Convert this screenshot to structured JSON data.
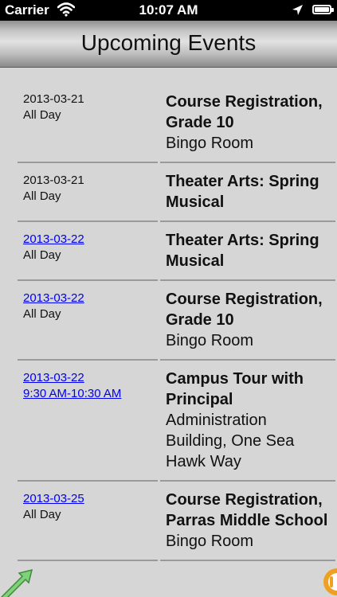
{
  "status_bar": {
    "carrier": "Carrier",
    "time": "10:07 AM",
    "icons": [
      "wifi-icon",
      "location-arrow-icon",
      "battery-icon"
    ]
  },
  "nav": {
    "title": "Upcoming Events"
  },
  "events": [
    {
      "date": "2013-03-21",
      "time": "All Day",
      "date_is_link": false,
      "time_is_link": false,
      "title": "Course Registration, Grade 10",
      "location": "Bingo Room"
    },
    {
      "date": "2013-03-21",
      "time": "All Day",
      "date_is_link": false,
      "time_is_link": false,
      "title": "Theater Arts: Spring Musical",
      "location": ""
    },
    {
      "date": "2013-03-22",
      "time": "All Day",
      "date_is_link": true,
      "time_is_link": false,
      "title": "Theater Arts: Spring Musical",
      "location": ""
    },
    {
      "date": "2013-03-22",
      "time": "All Day",
      "date_is_link": true,
      "time_is_link": false,
      "title": "Course Registration, Grade 10",
      "location": "Bingo Room"
    },
    {
      "date": "2013-03-22",
      "time": "9:30 AM-10:30 AM",
      "date_is_link": true,
      "time_is_link": true,
      "title": "Campus Tour with Principal",
      "location": "Administration Building, One Sea Hawk Way"
    },
    {
      "date": "2013-03-25",
      "time": "All Day",
      "date_is_link": true,
      "time_is_link": false,
      "title": "Course Registration, Parras Middle School",
      "location": "Bingo Room"
    }
  ],
  "colors": {
    "status_bar_bg": "#000000",
    "content_bg": "#d6d6d6",
    "link": "#0000ee",
    "divider": "#9a9a9a",
    "corner_arrow": "#7fd27a",
    "corner_badge": "#f0a020"
  }
}
